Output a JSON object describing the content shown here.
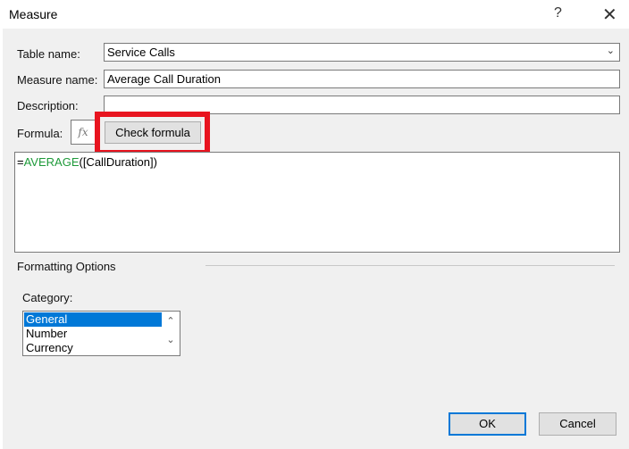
{
  "window": {
    "title": "Measure",
    "help": "?",
    "close": "✕"
  },
  "form": {
    "table_name_label": "Table name:",
    "table_name_value": "Service Calls",
    "measure_name_label": "Measure name:",
    "measure_name_value": "Average Call Duration",
    "description_label": "Description:",
    "description_value": "",
    "formula_label": "Formula:",
    "fx_label": "fx",
    "check_formula": "Check formula",
    "formula_prefix": "=",
    "formula_function": "AVERAGE",
    "formula_args": "([CallDuration])"
  },
  "formatting": {
    "header": "Formatting Options",
    "category_label": "Category:",
    "categories": [
      "General",
      "Number",
      "Currency"
    ],
    "selected": "General"
  },
  "buttons": {
    "ok": "OK",
    "cancel": "Cancel"
  },
  "colors": {
    "highlight": "#e8141f",
    "selection": "#0078d7",
    "function": "#1e9a3a"
  }
}
